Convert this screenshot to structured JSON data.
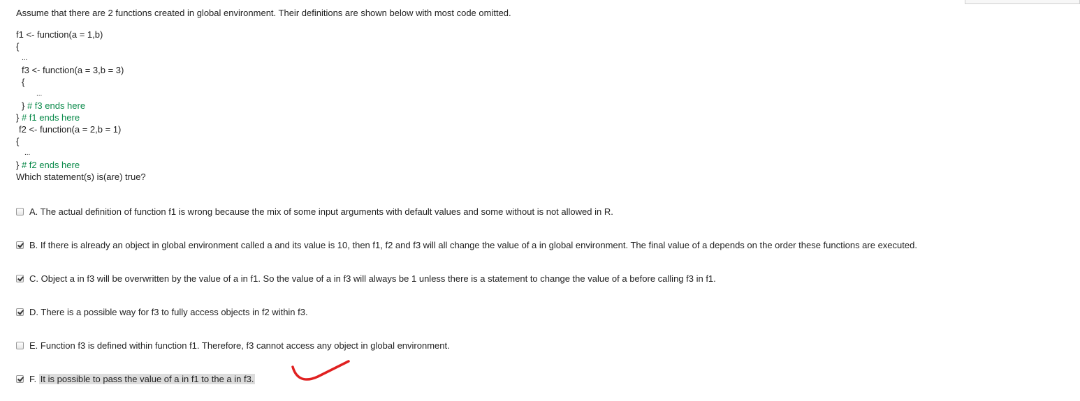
{
  "question": {
    "intro": "Assume that there are 2 functions created in global environment. Their definitions are shown below with most code omitted.",
    "code": {
      "l1": "f1 <- function(a = 1,b)",
      "l2": "{",
      "l3": "...",
      "l4": "f3 <- function(a = 3,b = 3)",
      "l5": "{",
      "l6": "...",
      "l7_code": "}",
      "l7_comment": " # f3 ends here",
      "l8_code": "}",
      "l8_comment": " # f1 ends here",
      "l9": "f2 <- function(a = 2,b = 1)",
      "l10": "{",
      "l11": "...",
      "l12_code": "}",
      "l12_comment": " # f2 ends here"
    },
    "prompt": "Which statement(s) is(are) true?"
  },
  "options": [
    {
      "label": "A. The actual definition of function f1 is wrong because the mix of some input arguments with default values and some without is not allowed in R.",
      "checked": false
    },
    {
      "label": "B. If there is already an object in global environment called a and its value is 10, then f1, f2 and f3 will all change the value of a in global environment. The final value of a depends on the order these functions are executed.",
      "checked": true
    },
    {
      "label": "C. Object a in f3 will be overwritten by the value of a in f1. So the value of a in f3 will always be 1 unless there is a statement to change the value of a before calling f3 in f1.",
      "checked": true
    },
    {
      "label": "D. There is a possible way for f3 to fully access objects in f2 within f3.",
      "checked": true
    },
    {
      "label": "E. Function f3 is defined within function f1. Therefore, f3 cannot access any object in global environment.",
      "checked": false
    },
    {
      "letter": "F.",
      "label": "It is possible to pass the value of a in f1 to the a in f3.",
      "checked": true
    }
  ],
  "colors": {
    "comment": "#0a8a4a",
    "annotation": "#e02020",
    "highlight": "#dcdcdc"
  },
  "icons": {
    "annotation": "red-checkmark-icon"
  }
}
